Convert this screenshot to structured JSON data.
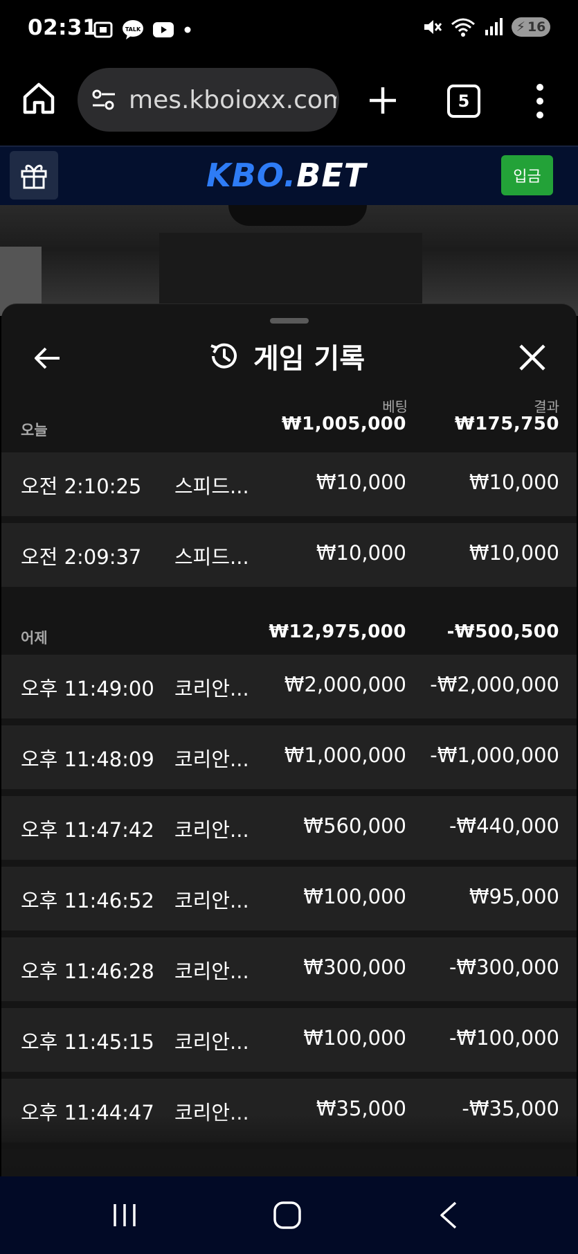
{
  "status_bar": {
    "time": "02:31",
    "talk_badge": "TALK",
    "battery": "16",
    "icons": [
      "screen-capture-icon",
      "kakaotalk-icon",
      "youtube-icon",
      "dot-icon",
      "mute-icon",
      "wifi-icon",
      "signal-icon",
      "battery-icon"
    ]
  },
  "browser": {
    "url": "mes.kboioxx.com",
    "tab_count": "5"
  },
  "site": {
    "logo_main": "KBO.",
    "logo_suffix": "BET",
    "deposit_label": "입금",
    "colors": {
      "logo_blue": "#2e7cf6",
      "deposit_green": "#23a238",
      "header_bg": "#04102e"
    }
  },
  "sheet": {
    "title": "게임 기록",
    "columns": {
      "bet_label": "베팅",
      "result_label": "결과"
    },
    "sections": [
      {
        "label": "오늘",
        "bet_total": "₩1,005,000",
        "result_total": "₩175,750",
        "rows": [
          {
            "time": "오전 2:10:25",
            "game": "스피드...",
            "bet": "₩10,000",
            "result": "₩10,000"
          },
          {
            "time": "오전 2:09:37",
            "game": "스피드...",
            "bet": "₩10,000",
            "result": "₩10,000"
          }
        ]
      },
      {
        "label": "어제",
        "bet_total": "₩12,975,000",
        "result_total": "-₩500,500",
        "rows": [
          {
            "time": "오후 11:49:00",
            "game": "코리안...",
            "bet": "₩2,000,000",
            "result": "-₩2,000,000"
          },
          {
            "time": "오후 11:48:09",
            "game": "코리안...",
            "bet": "₩1,000,000",
            "result": "-₩1,000,000"
          },
          {
            "time": "오후 11:47:42",
            "game": "코리안...",
            "bet": "₩560,000",
            "result": "-₩440,000"
          },
          {
            "time": "오후 11:46:52",
            "game": "코리안...",
            "bet": "₩100,000",
            "result": "₩95,000"
          },
          {
            "time": "오후 11:46:28",
            "game": "코리안...",
            "bet": "₩300,000",
            "result": "-₩300,000"
          },
          {
            "time": "오후 11:45:15",
            "game": "코리안...",
            "bet": "₩100,000",
            "result": "-₩100,000"
          },
          {
            "time": "오후 11:44:47",
            "game": "코리안...",
            "bet": "₩35,000",
            "result": "-₩35,000"
          }
        ]
      }
    ]
  }
}
